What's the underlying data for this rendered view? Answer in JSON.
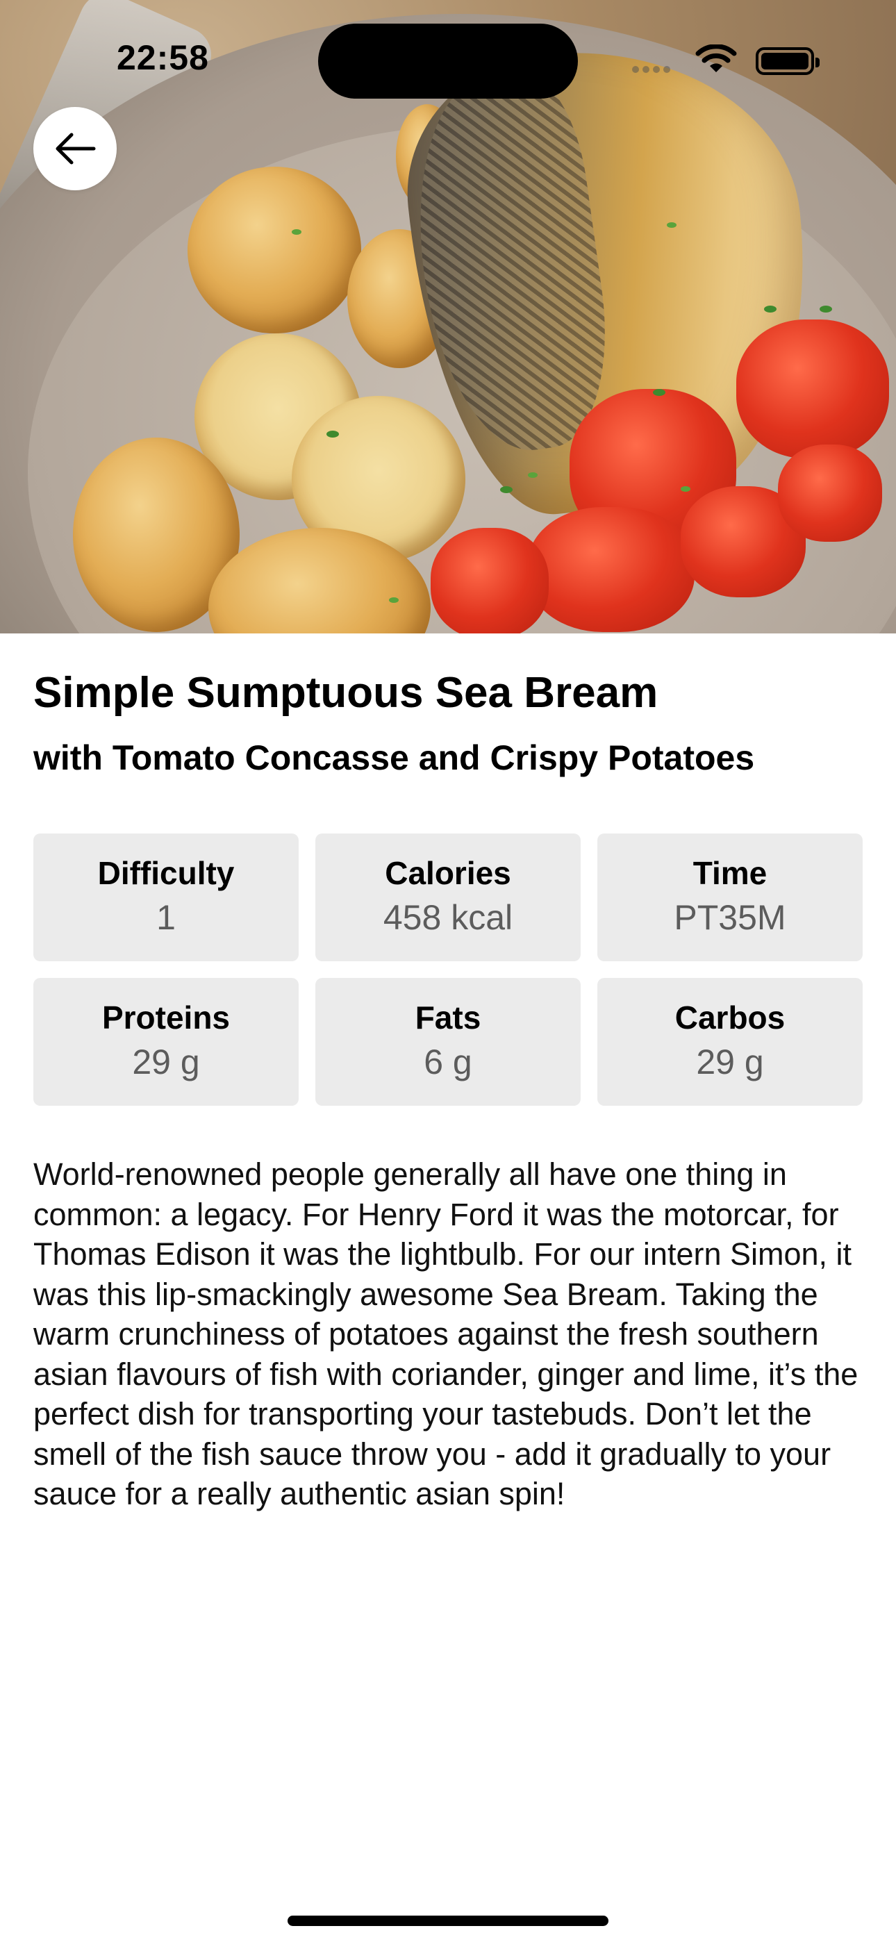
{
  "status_bar": {
    "time": "22:58"
  },
  "hero": {
    "image_alt": "Sea bream fillet with crispy potatoes and tomato concasse"
  },
  "nav": {
    "back_icon": "arrow-left-icon"
  },
  "recipe": {
    "title": "Simple Sumptuous Sea Bream",
    "subtitle": "with Tomato Concasse and Crispy Potatoes",
    "stats": [
      {
        "label": "Difficulty",
        "value": "1"
      },
      {
        "label": "Calories",
        "value": "458 kcal"
      },
      {
        "label": "Time",
        "value": "PT35M"
      },
      {
        "label": "Proteins",
        "value": "29 g"
      },
      {
        "label": "Fats",
        "value": "6 g"
      },
      {
        "label": "Carbos",
        "value": "29 g"
      }
    ],
    "description": "World-renowned people generally all have one thing in common: a legacy. For Henry Ford it was the motorcar, for Thomas Edison it was the lightbulb. For our intern Simon, it was this lip-smackingly awesome Sea Bream. Taking the warm crunchiness of potatoes against the fresh southern asian flavours of fish with coriander, ginger and lime, it’s the perfect dish for transporting your tastebuds. Don’t let the smell of the fish sauce throw you - add it gradually to your sauce for a really authentic asian spin!"
  },
  "colors": {
    "stat_background": "#ebebeb",
    "stat_value_text": "#5c5c5c",
    "page_background": "#ffffff"
  }
}
